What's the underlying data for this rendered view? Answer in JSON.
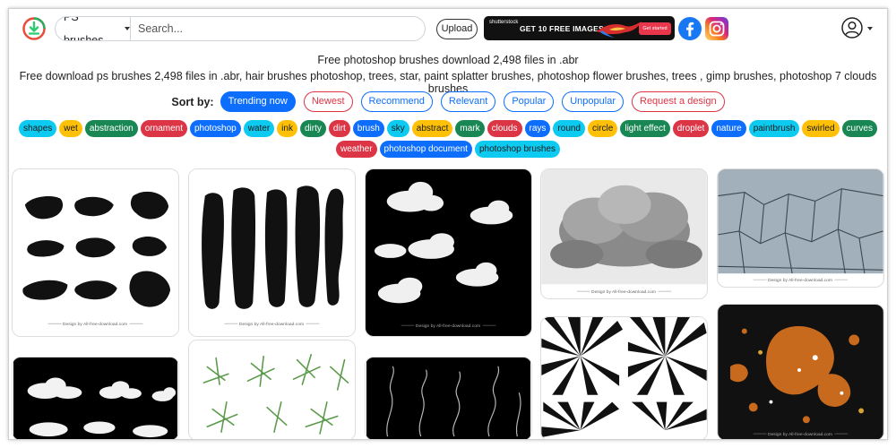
{
  "header": {
    "search_category": "PS brushes",
    "search_placeholder": "Search...",
    "upload_label": "Upload",
    "banner": {
      "brand": "shutterstock",
      "text": "GET 10 FREE IMAGES",
      "cta": "Get started"
    }
  },
  "page": {
    "title": "Free photoshop brushes download 2,498 files in .abr",
    "subtitle": "Free download ps brushes 2,498 files in .abr, hair brushes photoshop, trees, star, paint splatter brushes, photoshop flower brushes, trees , gimp brushes, photoshop 7 clouds brushes"
  },
  "sort": {
    "label": "Sort by:",
    "options": [
      {
        "label": "Trending now",
        "style": "active"
      },
      {
        "label": "Newest",
        "style": "red"
      },
      {
        "label": "Recommend",
        "style": "blue"
      },
      {
        "label": "Relevant",
        "style": "blue"
      },
      {
        "label": "Popular",
        "style": "blue"
      },
      {
        "label": "Unpopular",
        "style": "blue"
      },
      {
        "label": "Request a design",
        "style": "red"
      }
    ]
  },
  "tags": [
    {
      "label": "shapes",
      "color": "cyan"
    },
    {
      "label": "wet",
      "color": "yellow"
    },
    {
      "label": "abstraction",
      "color": "green"
    },
    {
      "label": "ornament",
      "color": "red"
    },
    {
      "label": "photoshop",
      "color": "blue"
    },
    {
      "label": "water",
      "color": "cyan"
    },
    {
      "label": "ink",
      "color": "yellow"
    },
    {
      "label": "dirty",
      "color": "green"
    },
    {
      "label": "dirt",
      "color": "red"
    },
    {
      "label": "brush",
      "color": "blue"
    },
    {
      "label": "sky",
      "color": "cyan"
    },
    {
      "label": "abstract",
      "color": "yellow"
    },
    {
      "label": "mark",
      "color": "green"
    },
    {
      "label": "clouds",
      "color": "red"
    },
    {
      "label": "rays",
      "color": "blue"
    },
    {
      "label": "round",
      "color": "cyan"
    },
    {
      "label": "circle",
      "color": "yellow"
    },
    {
      "label": "light effect",
      "color": "green"
    },
    {
      "label": "droplet",
      "color": "red"
    },
    {
      "label": "nature",
      "color": "blue"
    },
    {
      "label": "paintbrush",
      "color": "cyan"
    },
    {
      "label": "swirled",
      "color": "yellow"
    },
    {
      "label": "curves",
      "color": "green"
    },
    {
      "label": "weather",
      "color": "red"
    },
    {
      "label": "photoshop document",
      "color": "blue"
    },
    {
      "label": "photoshop brushes",
      "color": "cyan"
    }
  ],
  "cards": {
    "credit": "Design by All-free-download.com"
  },
  "colors": {
    "primary": "#0d6efd",
    "danger": "#dc3545",
    "success": "#198754",
    "info": "#0dcaf0",
    "warning": "#ffc107"
  },
  "icons": {
    "logo": "download-logo-icon",
    "facebook": "facebook-icon",
    "instagram": "instagram-icon",
    "user": "user-avatar-icon"
  }
}
